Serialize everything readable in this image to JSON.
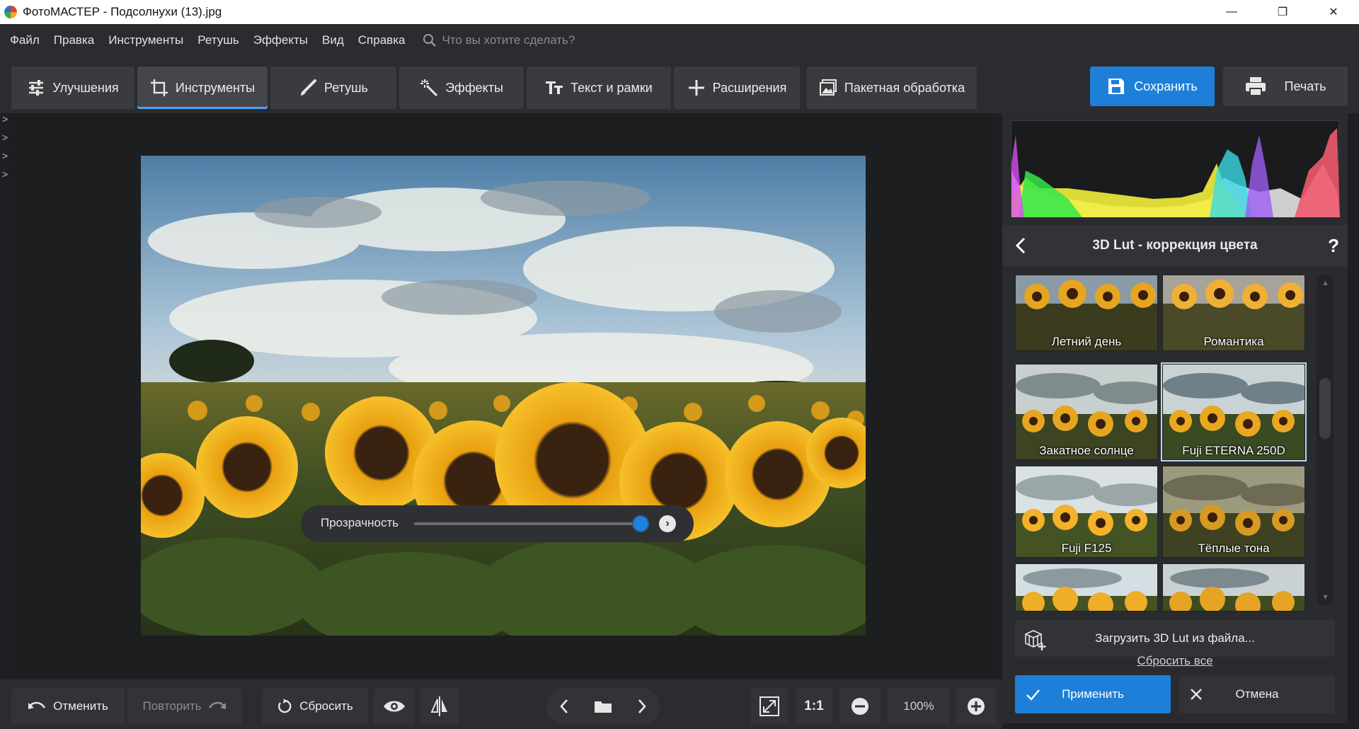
{
  "window": {
    "title": "ФотоМАСТЕР - Подсолнухи (13).jpg",
    "minimize": "—",
    "maximize": "❐",
    "close": "✕"
  },
  "menu": {
    "items": [
      "Файл",
      "Правка",
      "Инструменты",
      "Ретушь",
      "Эффекты",
      "Вид",
      "Справка"
    ],
    "search_placeholder": "Что вы хотите сделать?"
  },
  "tabs": {
    "improvements": "Улучшения",
    "tools": "Инструменты",
    "retouch": "Ретушь",
    "effects": "Эффекты",
    "text": "Текст и рамки",
    "extensions": "Расширения",
    "batch": "Пакетная обработка"
  },
  "actions": {
    "save": "Сохранить",
    "print": "Печать"
  },
  "panel": {
    "title": "3D Lut - коррекция цвета",
    "help": "?",
    "luts": [
      {
        "label": "Летний день",
        "selected": false
      },
      {
        "label": "Романтика",
        "selected": false
      },
      {
        "label": "Закатное солнце",
        "selected": false
      },
      {
        "label": "Fuji ETERNA 250D",
        "selected": true
      },
      {
        "label": "Fuji F125",
        "selected": false
      },
      {
        "label": "Тёплые тона",
        "selected": false
      },
      {
        "label": "",
        "selected": false
      },
      {
        "label": "",
        "selected": false
      }
    ],
    "load_lut": "Загрузить 3D Lut из файла...",
    "reset_all": "Сбросить все",
    "apply": "Применить",
    "cancel": "Отмена"
  },
  "opacity": {
    "label": "Прозрачность",
    "value": 1.0
  },
  "bottom": {
    "undo": "Отменить",
    "redo": "Повторить",
    "reset": "Сбросить",
    "zoom_1to1": "1:1",
    "zoom_value": "100%"
  },
  "colors": {
    "accent": "#1e7fd8",
    "panel": "#2a2b2e",
    "background": "#1e1f22"
  }
}
